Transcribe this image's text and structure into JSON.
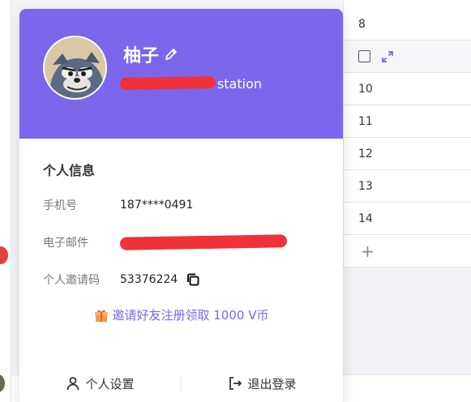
{
  "background_table": {
    "rows": [
      "8",
      "",
      "10",
      "11",
      "12",
      "13",
      "14"
    ],
    "add_symbol": "+"
  },
  "profile": {
    "username": "柚子",
    "org_suffix": "station"
  },
  "info": {
    "title": "个人信息",
    "phone_label": "手机号",
    "phone_value": "187****0491",
    "email_label": "电子邮件",
    "invite_label": "个人邀请码",
    "invite_value": "53376224"
  },
  "invite_link": {
    "text": "邀请好友注册领取 1000 V币",
    "gift_icon": "gift-icon"
  },
  "footer": {
    "settings_label": "个人设置",
    "logout_label": "退出登录"
  },
  "colors": {
    "accent": "#7b66ec",
    "redaction": "#f0313a"
  }
}
